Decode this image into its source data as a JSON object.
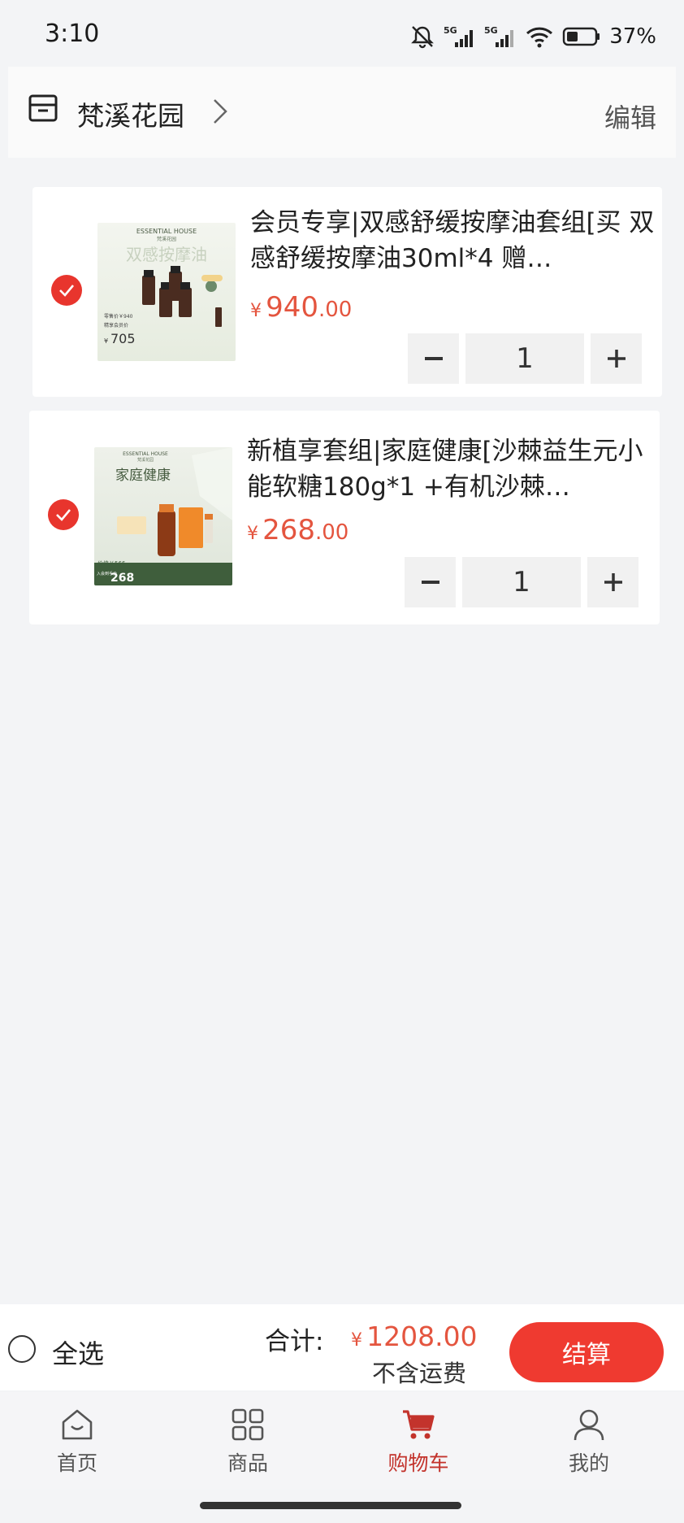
{
  "status_bar": {
    "time": "3:10",
    "battery": "37%",
    "icons": [
      "mute-bell-icon",
      "signal-5g-icon",
      "signal-5g-icon",
      "wifi-icon",
      "battery-icon"
    ]
  },
  "header": {
    "store_name": "梵溪花园",
    "edit_label": "编辑"
  },
  "cart": {
    "items": [
      {
        "title": "会员专享|双感舒缓按摩油套组[买 双感舒缓按摩油30ml*4 赠…",
        "price_symbol": "¥",
        "price_int": "940",
        "price_dec": ".00",
        "quantity": "1",
        "checked": true,
        "thumb": {
          "brand": "ESSENTIAL HOUSE",
          "brand_cn": "梵溪花园",
          "headline": "双感按摩油",
          "price_note": "零售价￥940",
          "member_label": "精享会员价",
          "member_price": "705"
        }
      },
      {
        "title": "新植享套组|家庭健康[沙棘益生元小能软糖180g*1 +有机沙棘…",
        "price_symbol": "¥",
        "price_int": "268",
        "price_dec": ".00",
        "quantity": "1",
        "checked": true,
        "thumb": {
          "brand": "ESSENTIAL HOUSE",
          "brand_cn": "梵溪花园",
          "headline": "家庭健康",
          "price_note": "价值￥566",
          "member_label": "入会到手价",
          "member_price": "268"
        }
      }
    ]
  },
  "summary": {
    "select_all_label": "全选",
    "total_label": "合计:",
    "total_symbol": "¥",
    "total_amount": "1208.00",
    "shipping_note": "不含运费",
    "checkout_label": "结算"
  },
  "tabs": [
    {
      "label": "首页",
      "icon": "home-icon"
    },
    {
      "label": "商品",
      "icon": "grid-icon"
    },
    {
      "label": "购物车",
      "icon": "cart-icon",
      "active": true
    },
    {
      "label": "我的",
      "icon": "user-icon"
    }
  ],
  "colors": {
    "accent": "#ef3a30",
    "price": "#e4553f",
    "active_tab": "#c3332c",
    "background": "#f3f4f6"
  }
}
